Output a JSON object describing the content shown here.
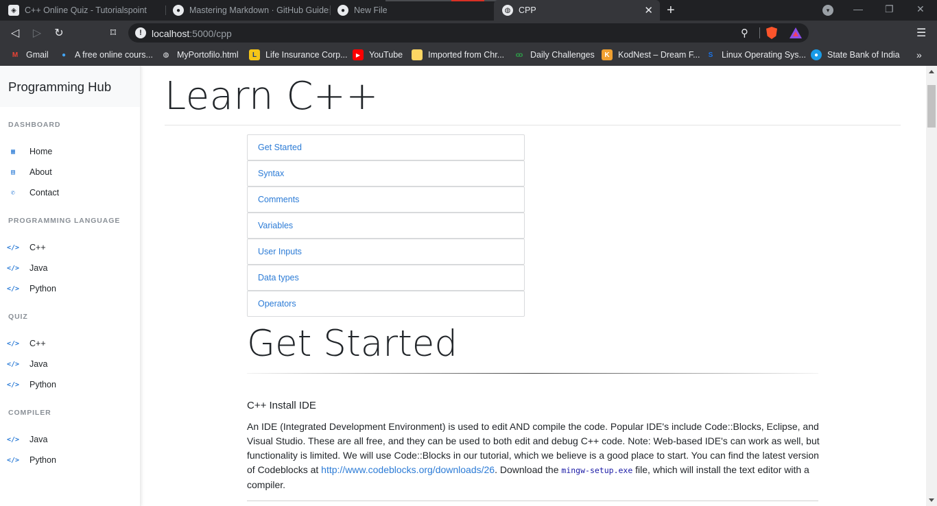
{
  "browser": {
    "tabs": [
      {
        "title": "C++ Online Quiz - Tutorialspoint",
        "icon": "tutorialspoint-icon"
      },
      {
        "title": "Mastering Markdown · GitHub Guides",
        "icon": "github-icon"
      },
      {
        "title": "New File",
        "icon": "github-icon"
      },
      {
        "title": "CPP",
        "icon": "globe-icon",
        "active": true
      }
    ],
    "new_tab": "+",
    "address": {
      "host": "localhost",
      "path": ":5000/cpp"
    },
    "bookmarks": [
      {
        "label": "Gmail",
        "icon": "gmail-icon",
        "color": "#ea4335"
      },
      {
        "label": "A free online cours...",
        "icon": "course-icon",
        "color": "#42a5f5"
      },
      {
        "label": "MyPortofilo.html",
        "icon": "globe-icon",
        "color": "#e8eaed"
      },
      {
        "label": "Life Insurance Corp...",
        "icon": "lic-icon",
        "color": "#f5c518"
      },
      {
        "label": "YouTube",
        "icon": "youtube-icon",
        "color": "#ff0000"
      },
      {
        "label": "Imported from Chr...",
        "icon": "folder-icon",
        "color": "#fdd663"
      },
      {
        "label": "Daily Challenges",
        "icon": "gfg-icon",
        "color": "#2f8d46"
      },
      {
        "label": "KodNest – Dream F...",
        "icon": "kodnest-icon",
        "color": "#f0a030"
      },
      {
        "label": "Linux Operating Sys...",
        "icon": "linux-s-icon",
        "color": "#1a73e8"
      },
      {
        "label": "State Bank of India",
        "icon": "sbi-icon",
        "color": "#1a9be6"
      }
    ]
  },
  "sidebar": {
    "brand": "Programming Hub",
    "sections": [
      {
        "heading": "DASHBOARD",
        "items": [
          {
            "label": "Home",
            "icon": "grid-icon"
          },
          {
            "label": "About",
            "icon": "id-card-icon"
          },
          {
            "label": "Contact",
            "icon": "phone-icon"
          }
        ]
      },
      {
        "heading": "PROGRAMMING LANGUAGE",
        "items": [
          {
            "label": "C++",
            "icon": "code-icon"
          },
          {
            "label": "Java",
            "icon": "code-icon"
          },
          {
            "label": "Python",
            "icon": "code-icon"
          }
        ]
      },
      {
        "heading": "QUIZ",
        "items": [
          {
            "label": "C++",
            "icon": "code-icon"
          },
          {
            "label": "Java",
            "icon": "code-icon"
          },
          {
            "label": "Python",
            "icon": "code-icon"
          }
        ]
      },
      {
        "heading": "COMPILER",
        "items": [
          {
            "label": "Java",
            "icon": "code-icon"
          },
          {
            "label": "Python",
            "icon": "code-icon"
          }
        ]
      }
    ]
  },
  "main": {
    "title": "Learn C++",
    "topics": [
      "Get Started",
      "Syntax",
      "Comments",
      "Variables",
      "User Inputs",
      "Data types",
      "Operators"
    ],
    "section": {
      "title": "Get Started",
      "subheading": "C++ Install IDE",
      "para_before_link": "An IDE (Integrated Development Environment) is used to edit AND compile the code. Popular IDE's include Code::Blocks, Eclipse, and Visual Studio. These are all free, and they can be used to both edit and debug C++ code. Note: Web-based IDE's can work as well, but functionality is limited. We will use Code::Blocks in our tutorial, which we believe is a good place to start. You can find the latest version of Codeblocks at ",
      "link": "http://www.codeblocks.org/downloads/26",
      "para_mid": ". Download the ",
      "code": "mingw-setup.exe",
      "para_after": " file, which will install the text editor with a compiler."
    }
  },
  "colors": {
    "accent": "#2b7bd6",
    "text": "#212529",
    "chrome_dark": "#202124",
    "chrome": "#35363a"
  }
}
